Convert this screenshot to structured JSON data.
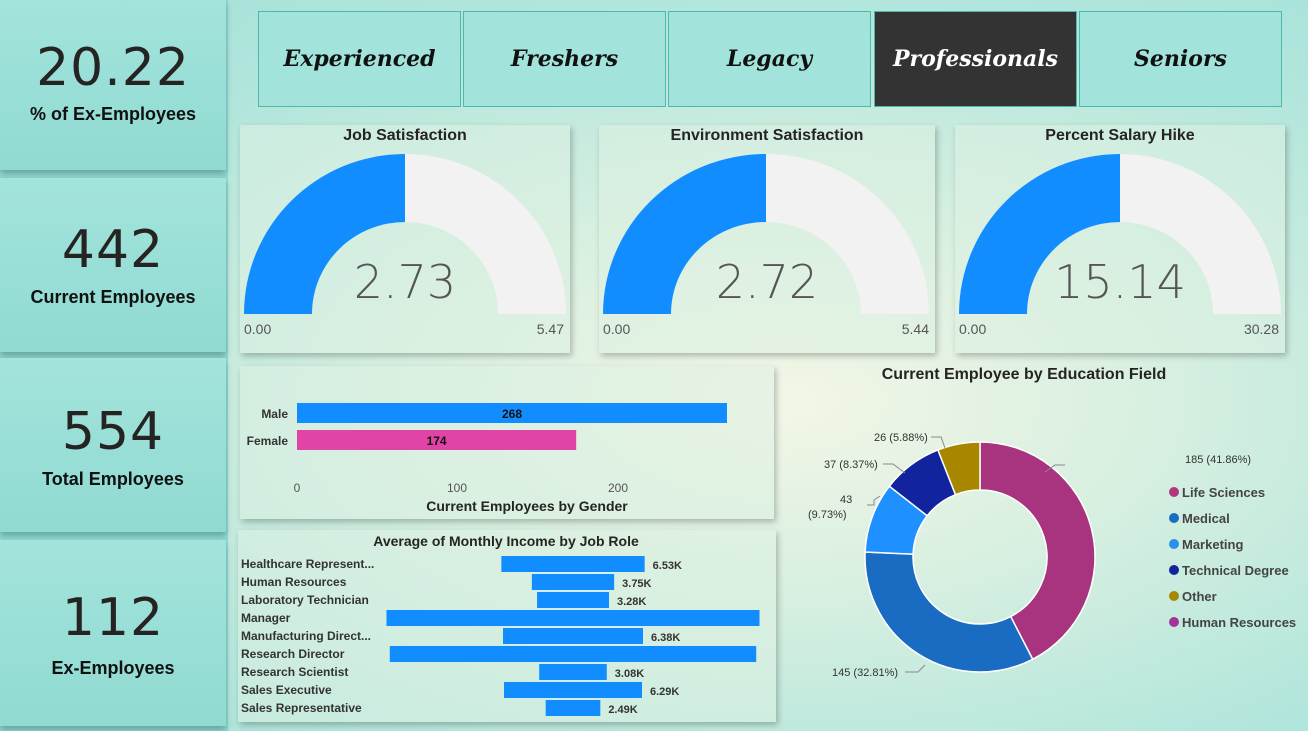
{
  "kpis": [
    {
      "value": "20.22",
      "label": "% of Ex-Employees"
    },
    {
      "value": "442",
      "label": "Current Employees"
    },
    {
      "value": "554",
      "label": "Total Employees"
    },
    {
      "value": "112",
      "label": "Ex-Employees"
    }
  ],
  "slicers": [
    "Experienced",
    "Freshers",
    "Legacy",
    "Professionals",
    "Seniors"
  ],
  "selected_slicer": "Professionals",
  "colors": {
    "blue": "#118dff",
    "track": "#f2f2f2",
    "pink": "#e044a7",
    "selected": "#333333"
  },
  "gauges": [
    {
      "title": "Job Satisfaction",
      "value": "2.73",
      "min": "0.00",
      "max": "5.47"
    },
    {
      "title": "Environment Satisfaction",
      "value": "2.72",
      "min": "0.00",
      "max": "5.44"
    },
    {
      "title": "Percent Salary Hike",
      "value": "15.14",
      "min": "0.00",
      "max": "30.28"
    }
  ],
  "gender_chart": {
    "title": "Current Employees by Gender",
    "categories": [
      "Male",
      "Female"
    ],
    "values": [
      268,
      174
    ],
    "colors": [
      "#118dff",
      "#e044a7"
    ],
    "ticks": [
      "0",
      "100",
      "200"
    ]
  },
  "income_chart": {
    "title": "Average of Monthly Income by Job Role",
    "roles": [
      "Healthcare Represent...",
      "Human Resources",
      "Laboratory Technician",
      "Manager",
      "Manufacturing Direct...",
      "Research Director",
      "Research Scientist",
      "Sales Executive",
      "Sales Representative"
    ],
    "values": [
      6.53,
      3.75,
      3.28,
      17.0,
      6.38,
      16.7,
      3.08,
      6.29,
      2.49
    ],
    "labels": [
      "6.53K",
      "3.75K",
      "3.28K",
      "",
      "6.38K",
      "",
      "3.08K",
      "6.29K",
      "2.49K"
    ]
  },
  "chart_data": {
    "type": "pie",
    "title": "Current Employee by Education Field",
    "labels": [
      "Life Sciences",
      "Medical",
      "Marketing",
      "Technical Degree",
      "Other",
      "Human Resources"
    ],
    "values": [
      185,
      145,
      43,
      37,
      26,
      6
    ],
    "slice_order": [
      "Human Resources",
      "Medical",
      "Marketing",
      "Technical Degree",
      "Other"
    ],
    "slice_values": [
      185,
      145,
      43,
      37,
      26
    ],
    "data_labels": [
      "185 (41.86%)",
      "145 (32.81%)",
      "43",
      "(9.73%)",
      "37 (8.37%)",
      "26 (5.88%)"
    ],
    "legend_colors": [
      "#b3377f",
      "#1a6bc2",
      "#2d8fe8",
      "#12239e",
      "#a88700",
      "#a1339a"
    ],
    "slice_colors": [
      "#a8337f",
      "#1a6bc2",
      "#1e90ff",
      "#12239e",
      "#a88700"
    ],
    "legend": "right"
  }
}
